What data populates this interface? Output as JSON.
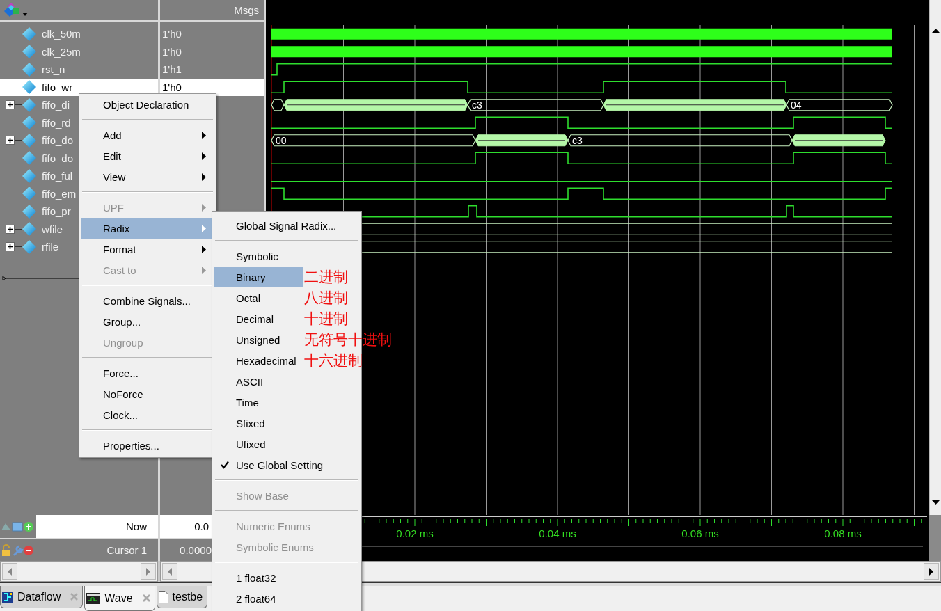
{
  "header": {
    "values_title": "Msgs"
  },
  "signals": [
    {
      "name": "clk_50m",
      "value": "1'h0",
      "expandable": false,
      "selected": false
    },
    {
      "name": "clk_25m",
      "value": "1'h0",
      "expandable": false,
      "selected": false
    },
    {
      "name": "rst_n",
      "value": "1'h1",
      "expandable": false,
      "selected": false
    },
    {
      "name": "fifo_wr",
      "value": "1'h0",
      "expandable": false,
      "selected": true
    },
    {
      "name": "fifo_di",
      "expandable": true,
      "selected": false,
      "wave_labels": [
        "c3",
        "04"
      ]
    },
    {
      "name": "fifo_rd",
      "expandable": false,
      "selected": false
    },
    {
      "name": "fifo_do",
      "expandable": true,
      "selected": false,
      "wave_labels": [
        "00",
        "c3"
      ]
    },
    {
      "name": "fifo_do",
      "expandable": false,
      "selected": false
    },
    {
      "name": "fifo_ful",
      "expandable": false,
      "selected": false
    },
    {
      "name": "fifo_em",
      "expandable": false,
      "selected": false
    },
    {
      "name": "fifo_pr",
      "expandable": false,
      "selected": false
    },
    {
      "name": "wfile",
      "expandable": true,
      "selected": false
    },
    {
      "name": "rfile",
      "expandable": true,
      "selected": false
    }
  ],
  "now_row": {
    "label": "Now",
    "value": "0.0"
  },
  "cursor_row": {
    "label": "Cursor 1",
    "value": "0.0000"
  },
  "time_axis": {
    "labels": [
      "0.02 ms",
      "0.04 ms",
      "0.06 ms",
      "0.08 ms"
    ]
  },
  "tabs": [
    {
      "label": "Dataflow",
      "selected": false,
      "close_button": true
    },
    {
      "label": "Wave",
      "selected": true,
      "close_button": true
    },
    {
      "label": "testbe",
      "selected": false,
      "close_button": false
    }
  ],
  "context_menu": {
    "items": [
      {
        "kind": "item",
        "label": "Object Declaration",
        "disabled": false,
        "has_submenu": false,
        "selected": false
      },
      {
        "kind": "separator"
      },
      {
        "kind": "item",
        "label": "Add",
        "disabled": false,
        "has_submenu": true,
        "selected": false
      },
      {
        "kind": "item",
        "label": "Edit",
        "disabled": false,
        "has_submenu": true,
        "selected": false
      },
      {
        "kind": "item",
        "label": "View",
        "disabled": false,
        "has_submenu": true,
        "selected": false
      },
      {
        "kind": "separator"
      },
      {
        "kind": "item",
        "label": "UPF",
        "disabled": true,
        "has_submenu": true,
        "selected": false
      },
      {
        "kind": "item",
        "label": "Radix",
        "disabled": false,
        "has_submenu": true,
        "selected": true
      },
      {
        "kind": "item",
        "label": "Format",
        "disabled": false,
        "has_submenu": true,
        "selected": false
      },
      {
        "kind": "item",
        "label": "Cast to",
        "disabled": true,
        "has_submenu": true,
        "selected": false
      },
      {
        "kind": "separator"
      },
      {
        "kind": "item",
        "label": "Combine Signals...",
        "disabled": false,
        "has_submenu": false,
        "selected": false
      },
      {
        "kind": "item",
        "label": "Group...",
        "disabled": false,
        "has_submenu": false,
        "selected": false
      },
      {
        "kind": "item",
        "label": "Ungroup",
        "disabled": true,
        "has_submenu": false,
        "selected": false
      },
      {
        "kind": "separator"
      },
      {
        "kind": "item",
        "label": "Force...",
        "disabled": false,
        "has_submenu": false,
        "selected": false
      },
      {
        "kind": "item",
        "label": "NoForce",
        "disabled": false,
        "has_submenu": false,
        "selected": false
      },
      {
        "kind": "item",
        "label": "Clock...",
        "disabled": false,
        "has_submenu": false,
        "selected": false
      },
      {
        "kind": "separator"
      },
      {
        "kind": "item",
        "label": "Properties...",
        "disabled": false,
        "has_submenu": false,
        "selected": false
      }
    ]
  },
  "radix_submenu": {
    "items": [
      {
        "kind": "item",
        "label": "Global Signal Radix...",
        "disabled": false,
        "checked": false,
        "selected": false
      },
      {
        "kind": "separator"
      },
      {
        "kind": "item",
        "label": "Symbolic",
        "disabled": false,
        "checked": false,
        "selected": false
      },
      {
        "kind": "item",
        "label": "Binary",
        "disabled": false,
        "checked": false,
        "selected": true,
        "note": "二进制"
      },
      {
        "kind": "item",
        "label": "Octal",
        "disabled": false,
        "checked": false,
        "selected": false,
        "note": "八进制"
      },
      {
        "kind": "item",
        "label": "Decimal",
        "disabled": false,
        "checked": false,
        "selected": false,
        "note": "十进制"
      },
      {
        "kind": "item",
        "label": "Unsigned",
        "disabled": false,
        "checked": false,
        "selected": false,
        "note": "无符号十进制"
      },
      {
        "kind": "item",
        "label": "Hexadecimal",
        "disabled": false,
        "checked": false,
        "selected": false,
        "note": "十六进制"
      },
      {
        "kind": "item",
        "label": "ASCII",
        "disabled": false,
        "checked": false,
        "selected": false
      },
      {
        "kind": "item",
        "label": "Time",
        "disabled": false,
        "checked": false,
        "selected": false
      },
      {
        "kind": "item",
        "label": "Sfixed",
        "disabled": false,
        "checked": false,
        "selected": false
      },
      {
        "kind": "item",
        "label": "Ufixed",
        "disabled": false,
        "checked": false,
        "selected": false
      },
      {
        "kind": "item",
        "label": "Use Global Setting",
        "disabled": false,
        "checked": true,
        "selected": false
      },
      {
        "kind": "separator"
      },
      {
        "kind": "item",
        "label": "Show Base",
        "disabled": true,
        "checked": false,
        "selected": false
      },
      {
        "kind": "separator"
      },
      {
        "kind": "item",
        "label": "Numeric Enums",
        "disabled": true,
        "checked": false,
        "selected": false
      },
      {
        "kind": "item",
        "label": "Symbolic Enums",
        "disabled": true,
        "checked": false,
        "selected": false
      },
      {
        "kind": "separator"
      },
      {
        "kind": "item",
        "label": "1 float32",
        "disabled": false,
        "checked": false,
        "selected": false
      },
      {
        "kind": "item",
        "label": "2 float64",
        "disabled": false,
        "checked": false,
        "selected": false
      }
    ]
  }
}
